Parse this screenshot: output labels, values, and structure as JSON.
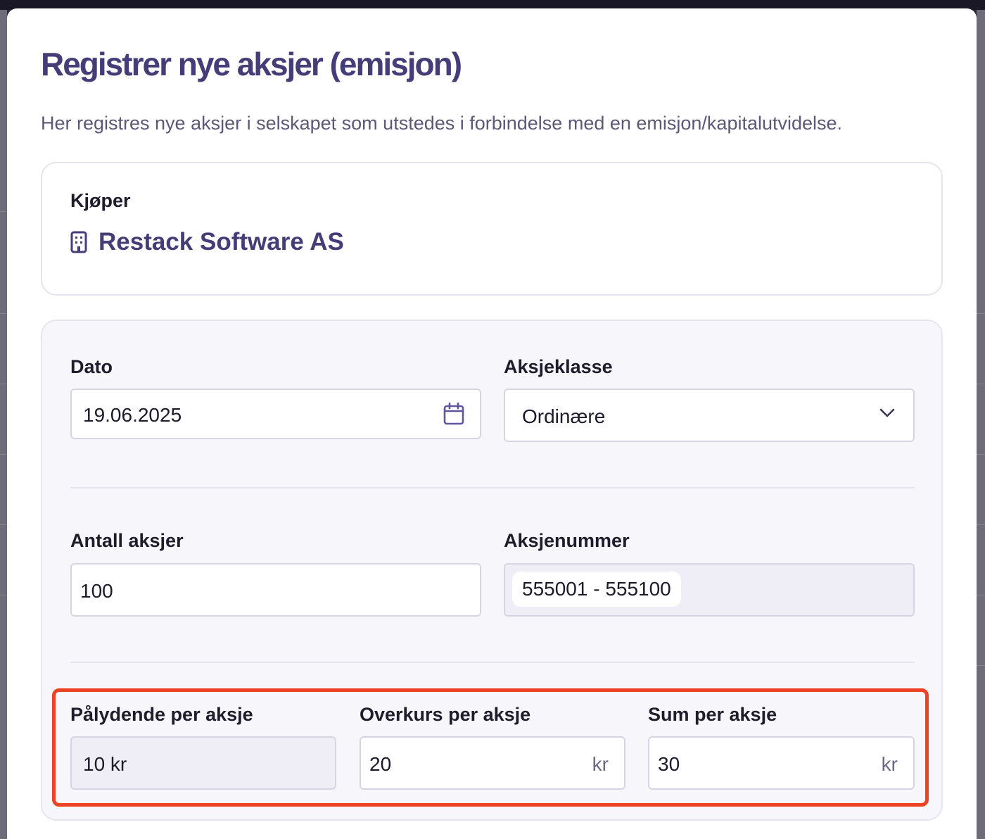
{
  "modal": {
    "title": "Registrer nye aksjer (emisjon)",
    "subtitle": "Her registres nye aksjer i selskapet som utstedes i forbindelse med en emisjon/kapitalutvidelse."
  },
  "buyer": {
    "label": "Kjøper",
    "icon": "building-icon",
    "name": "Restack Software AS"
  },
  "form": {
    "date": {
      "label": "Dato",
      "value": "19.06.2025",
      "icon": "calendar-icon"
    },
    "share_class": {
      "label": "Aksjeklasse",
      "value": "Ordinære",
      "icon": "chevron-down-icon"
    },
    "share_count": {
      "label": "Antall aksjer",
      "value": "100"
    },
    "share_numbers": {
      "label": "Aksjenummer",
      "value": "555001 - 555100"
    },
    "nominal_value": {
      "label": "Pålydende per aksje",
      "value": "10 kr"
    },
    "premium": {
      "label": "Overkurs per aksje",
      "value": "20",
      "suffix": "kr"
    },
    "sum": {
      "label": "Sum per aksje",
      "value": "30",
      "suffix": "kr"
    }
  },
  "colors": {
    "title": "#453d78",
    "highlight": "#ee4224",
    "card_bg": "#f7f7fb"
  }
}
